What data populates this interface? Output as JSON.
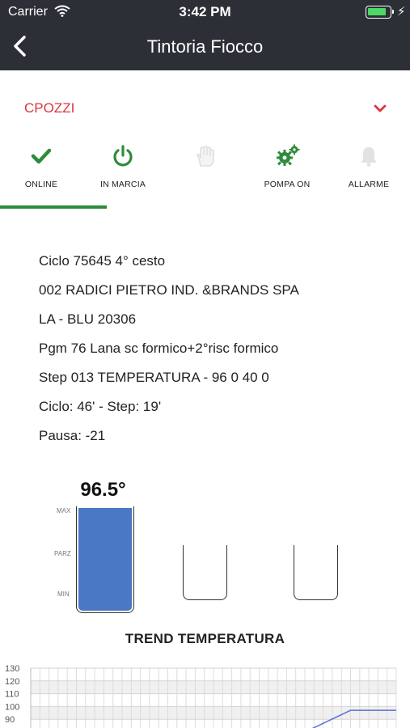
{
  "status": {
    "carrier": "Carrier",
    "time": "3:42 PM"
  },
  "navbar": {
    "title": "Tintoria Fiocco"
  },
  "selector": {
    "value": "CPOZZI"
  },
  "tabs": [
    {
      "label": "ONLINE",
      "icon": "check-icon",
      "color": "#2e8b3a",
      "active": true
    },
    {
      "label": "IN MARCIA",
      "icon": "power-icon",
      "color": "#2e8b3a",
      "active": false
    },
    {
      "label": "",
      "icon": "hand-icon",
      "color": "#e0e0e0",
      "active": false
    },
    {
      "label": "POMPA ON",
      "icon": "gears-icon",
      "color": "#2e8b3a",
      "active": false
    },
    {
      "label": "ALLARME",
      "icon": "bell-icon",
      "color": "#e0e0e0",
      "active": false
    }
  ],
  "info": {
    "lines": [
      "Ciclo 75645 4° cesto",
      "002 RADICI PIETRO IND. &BRANDS SPA",
      "LA - BLU 20306",
      "Pgm 76 Lana sc formico+2°risc formico",
      "Step 013 TEMPERATURA - 96 0 40 0",
      "Ciclo: 46' - Step: 19'",
      "Pausa: -21"
    ]
  },
  "tanks": {
    "value_label": "96.5°",
    "scale": [
      "MAX",
      "PARZ",
      "MIN"
    ],
    "levels": [
      1.0,
      0,
      0
    ]
  },
  "trend": {
    "title": "TREND TEMPERATURA"
  },
  "chart_data": {
    "type": "line",
    "title": "TREND TEMPERATURA",
    "yticks": [
      130,
      120,
      110,
      100,
      90
    ],
    "ylim": [
      80,
      130
    ],
    "grid": true,
    "series": [
      {
        "color": "#5a6fd6",
        "x": [
          0,
          30,
          35,
          40
        ],
        "y": [
          80,
          80,
          97,
          97
        ]
      }
    ],
    "xlim": [
      0,
      40
    ]
  },
  "colors": {
    "bar": "#2c3036",
    "accent_red": "#d9363e",
    "green": "#2e8b3a",
    "tank_fill": "#4a78c4"
  }
}
